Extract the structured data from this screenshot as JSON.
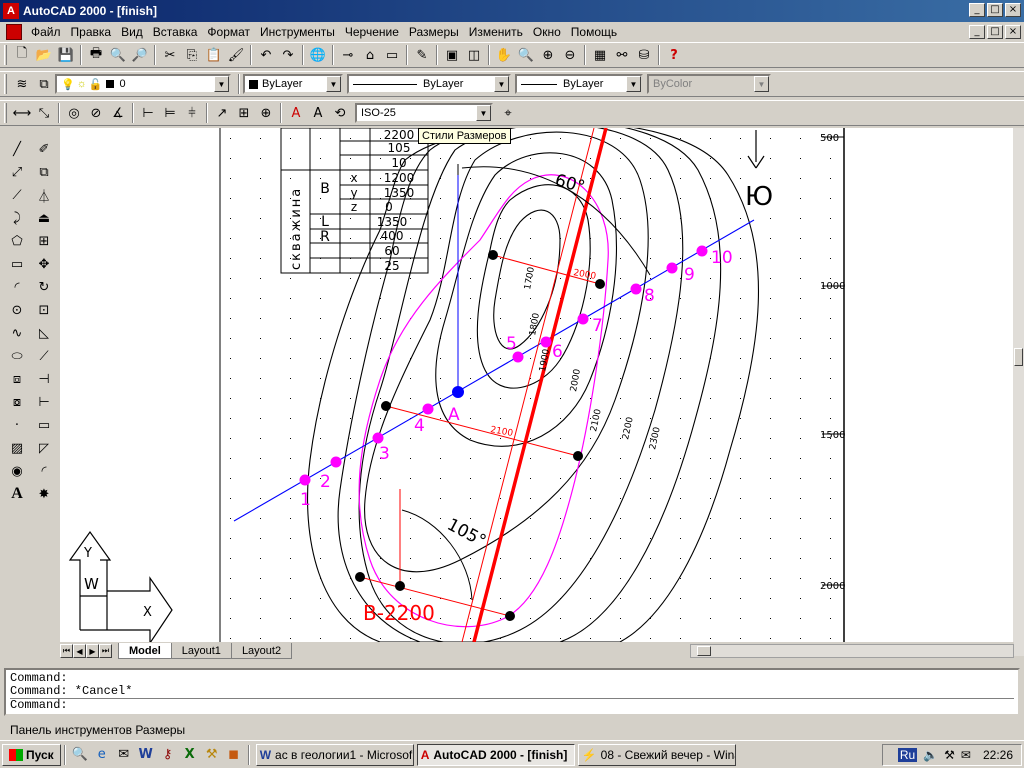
{
  "window": {
    "title": "AutoCAD 2000 - [finish]",
    "min": "_",
    "max": "□",
    "close": "×"
  },
  "menu": [
    "Файл",
    "Правка",
    "Вид",
    "Вставка",
    "Формат",
    "Инструменты",
    "Черчение",
    "Размеры",
    "Изменить",
    "Окно",
    "Помощь"
  ],
  "layer_toolbar": {
    "layer": "0",
    "color": "ByLayer",
    "linetype": "ByLayer",
    "lineweight": "ByLayer",
    "plotstyle": "ByColor"
  },
  "dim_toolbar": {
    "style": "ISO-25",
    "tooltip": "Стили Размеров"
  },
  "table": {
    "vertical_label": "скважина",
    "rows": [
      "2200",
      "105",
      "10",
      "1200",
      "1350",
      "0",
      "1350",
      "400",
      "60",
      "25"
    ],
    "labels": {
      "B": "B",
      "x": "x",
      "y": "y",
      "z": "z",
      "L": "L",
      "R": "R"
    }
  },
  "ruler": [
    "500",
    "1000",
    "1500",
    "2000"
  ],
  "drawing": {
    "points": [
      "1",
      "2",
      "3",
      "4",
      "5",
      "6",
      "7",
      "8",
      "9",
      "10"
    ],
    "point_a": "A",
    "north": "Ю",
    "angle_top": "60°",
    "angle_bottom": "105°",
    "well_label": "B-2200",
    "contours": [
      "1700",
      "1800",
      "1900",
      "2000",
      "2100",
      "2200",
      "2300"
    ],
    "red_labels": [
      "2000",
      "2100"
    ]
  },
  "ucs": {
    "y": "Y",
    "w": "W",
    "x": "X"
  },
  "layout_tabs": [
    "Model",
    "Layout1",
    "Layout2"
  ],
  "command_lines": [
    "Command:",
    "Command: *Cancel*",
    "Command:"
  ],
  "status_text": "Панель инструментов Размеры",
  "taskbar": {
    "start": "Пуск",
    "tasks": [
      "ас в геологии1 - Microsof...",
      "AutoCAD 2000 - [finish]",
      "08 - Свежий вечер - Wina..."
    ],
    "lang": "Ru",
    "clock": "22:26"
  },
  "colors": {
    "magenta": "#ff00ff",
    "red": "#ff0000",
    "blue": "#0000ff",
    "titlebar": "#0a246a"
  }
}
